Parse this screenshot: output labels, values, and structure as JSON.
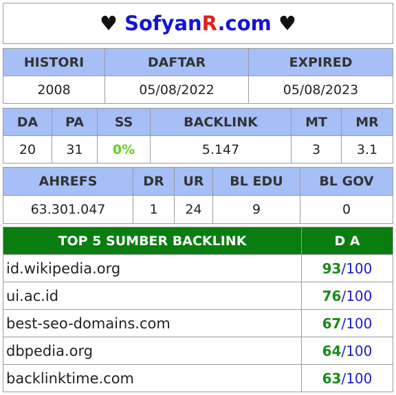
{
  "title": {
    "heart": "♥",
    "brand_main": "Sofyan",
    "brand_accent": "R",
    "brand_tail": ".com",
    "colors": {
      "main": "#1414d8",
      "accent": "#e0201c"
    }
  },
  "domain_info": {
    "headers": [
      "HISTORI",
      "DAFTAR",
      "EXPIRED"
    ],
    "values": [
      "2008",
      "05/08/2022",
      "05/08/2023"
    ]
  },
  "metrics": {
    "headers": [
      "DA",
      "PA",
      "SS",
      "BACKLINK",
      "MT",
      "MR"
    ],
    "values": [
      "20",
      "31",
      "0%",
      "5.147",
      "3",
      "3.1"
    ]
  },
  "ahrefs": {
    "headers": [
      "AHREFS",
      "DR",
      "UR",
      "BL EDU",
      "BL GOV"
    ],
    "values": [
      "63.301.047",
      "1",
      "24",
      "9",
      "0"
    ]
  },
  "top_backlinks": {
    "header_source": "TOP 5 SUMBER BACKLINK",
    "header_da": "D A",
    "separator": "/",
    "rows": [
      {
        "site": "id.wikipedia.org",
        "da": "93",
        "max": "100"
      },
      {
        "site": "ui.ac.id",
        "da": "76",
        "max": "100"
      },
      {
        "site": "best-seo-domains.com",
        "da": "67",
        "max": "100"
      },
      {
        "site": "dbpedia.org",
        "da": "64",
        "max": "100"
      },
      {
        "site": "backlinktime.com",
        "da": "63",
        "max": "100"
      }
    ]
  },
  "colors": {
    "header_bg": "#a6bff7",
    "top_header_bg": "#0a7d10",
    "percent_green": "#66cc22",
    "da_green": "#1a8a1a",
    "da_blue": "#1c1cc4"
  }
}
